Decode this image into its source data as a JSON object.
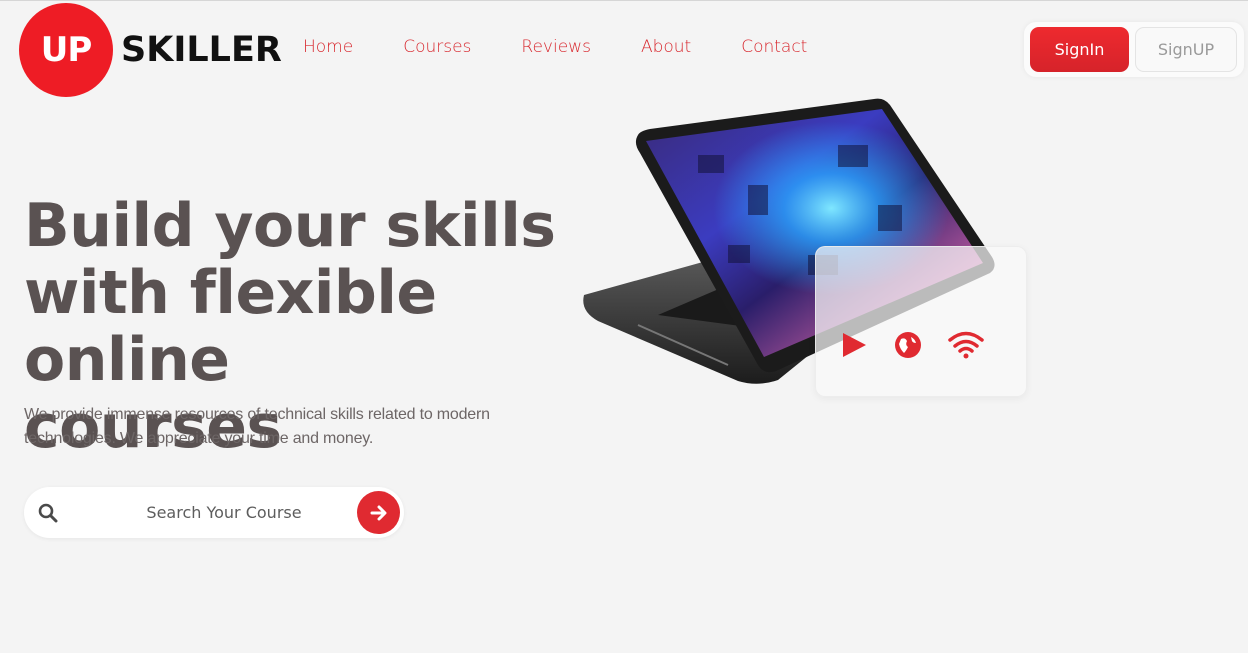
{
  "brand": {
    "badge": "UP",
    "word": "SKILLER",
    "accent": "#ee1c25"
  },
  "nav": {
    "items": [
      {
        "label": "Home"
      },
      {
        "label": "Courses"
      },
      {
        "label": "Reviews"
      },
      {
        "label": "About"
      },
      {
        "label": "Contact"
      }
    ]
  },
  "auth": {
    "signin_label": "SignIn",
    "signup_label": "SignUP"
  },
  "hero": {
    "title_line1": "Build your skills",
    "title_line2": "with flexible online",
    "title_line3": "courses",
    "description_line1": "We provide immense resources of technical skills related to modern",
    "description_line2": "technologies. We appreciate your time and money."
  },
  "search": {
    "placeholder": "Search Your Course",
    "value": ""
  },
  "icons": {
    "search": "search-icon",
    "submit": "arrow-right-icon",
    "play": "play-icon",
    "globe": "globe-icon",
    "wifi": "wifi-icon"
  },
  "colors": {
    "nav": "#d8292f",
    "title": "#5a5252",
    "button": "#e02a31"
  }
}
